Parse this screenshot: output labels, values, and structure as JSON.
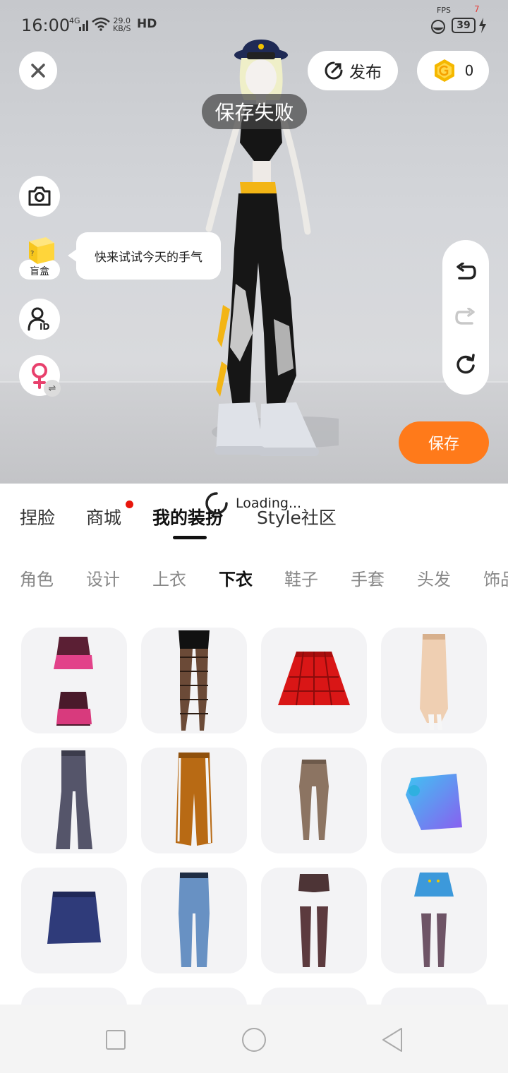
{
  "status_bar": {
    "time": "16:00",
    "network": "4G",
    "speed_value": "29.0",
    "speed_unit": "KB/S",
    "hd": "HD",
    "fps_label": "FPS",
    "fps_value": "7",
    "battery": "39"
  },
  "header": {
    "publish_label": "发布",
    "coin_count": "0"
  },
  "toast": "保存失败",
  "side": {
    "blindbox_label": "盲盒",
    "bubble_text": "快来试试今天的手气"
  },
  "save_label": "保存",
  "main_tabs": {
    "items": [
      {
        "label": "捏脸"
      },
      {
        "label": "商城"
      },
      {
        "label": "我的装扮"
      },
      {
        "label": "Style社区"
      }
    ],
    "active_index": 2,
    "loading_text": "Loading..."
  },
  "sub_tabs": {
    "items": [
      {
        "label": "角色"
      },
      {
        "label": "设计"
      },
      {
        "label": "上衣"
      },
      {
        "label": "下衣"
      },
      {
        "label": "鞋子"
      },
      {
        "label": "手套"
      },
      {
        "label": "头发"
      },
      {
        "label": "饰品"
      }
    ],
    "active_index": 3
  },
  "items": [
    {
      "name": "pink-skirt-set-item"
    },
    {
      "name": "fishnet-tights-item"
    },
    {
      "name": "red-plaid-skirt-item"
    },
    {
      "name": "beige-long-skirt-item"
    },
    {
      "name": "grey-flare-pants-item"
    },
    {
      "name": "orange-track-pants-item"
    },
    {
      "name": "brown-leggings-item"
    },
    {
      "name": "blue-sarong-item"
    },
    {
      "name": "navy-skirt-item"
    },
    {
      "name": "blue-jeans-item"
    },
    {
      "name": "shorts-with-stockings-item"
    },
    {
      "name": "blue-skirt-with-stockings-item"
    }
  ],
  "colors": {
    "accent": "#ff7a1a",
    "badge_dot": "#e8160c",
    "coin": "#f5b800"
  }
}
